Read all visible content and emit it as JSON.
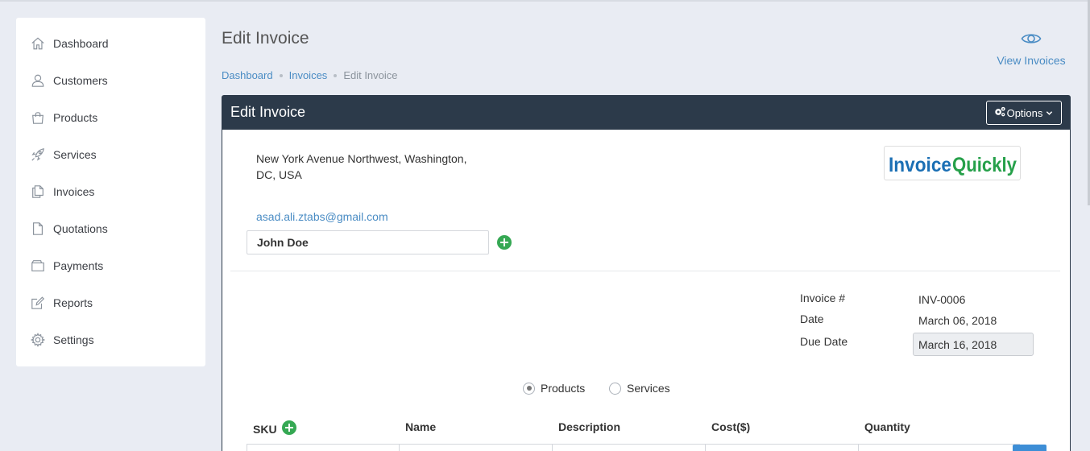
{
  "sidebar": {
    "items": [
      {
        "label": "Dashboard",
        "icon": "home-icon"
      },
      {
        "label": "Customers",
        "icon": "user-icon"
      },
      {
        "label": "Products",
        "icon": "shopping-bag-icon"
      },
      {
        "label": "Services",
        "icon": "rocket-icon"
      },
      {
        "label": "Invoices",
        "icon": "documents-icon"
      },
      {
        "label": "Quotations",
        "icon": "file-icon"
      },
      {
        "label": "Payments",
        "icon": "wallet-icon"
      },
      {
        "label": "Reports",
        "icon": "edit-icon"
      },
      {
        "label": "Settings",
        "icon": "gear-icon"
      }
    ]
  },
  "header": {
    "title": "Edit Invoice",
    "breadcrumb": [
      "Dashboard",
      "Invoices",
      "Edit Invoice"
    ],
    "view_invoices_label": "View Invoices"
  },
  "panel": {
    "title": "Edit Invoice",
    "options_label": "Options",
    "address_line1": "New York Avenue Northwest, Washington,",
    "address_line2": "DC, USA",
    "logo_part1": "InvoiceQuickly",
    "email": "asad.ali.ztabs@gmail.com",
    "customer_value": "John Doe",
    "invoice_number_label": "Invoice #",
    "invoice_number": "INV-0006",
    "date_label": "Date",
    "date": "March 06, 2018",
    "due_date_label": "Due Date",
    "due_date": "March 16, 2018",
    "item_type_options": [
      "Products",
      "Services"
    ],
    "item_type_selected": "Products",
    "columns": [
      "SKU",
      "Name",
      "Description",
      "Cost($)",
      "Quantity"
    ]
  },
  "colors": {
    "accent": "#4a8cc4",
    "panel_header": "#2c3a4a",
    "add_green": "#35a853",
    "logo_blue": "#1b6fb4",
    "logo_green": "#26a04a"
  }
}
